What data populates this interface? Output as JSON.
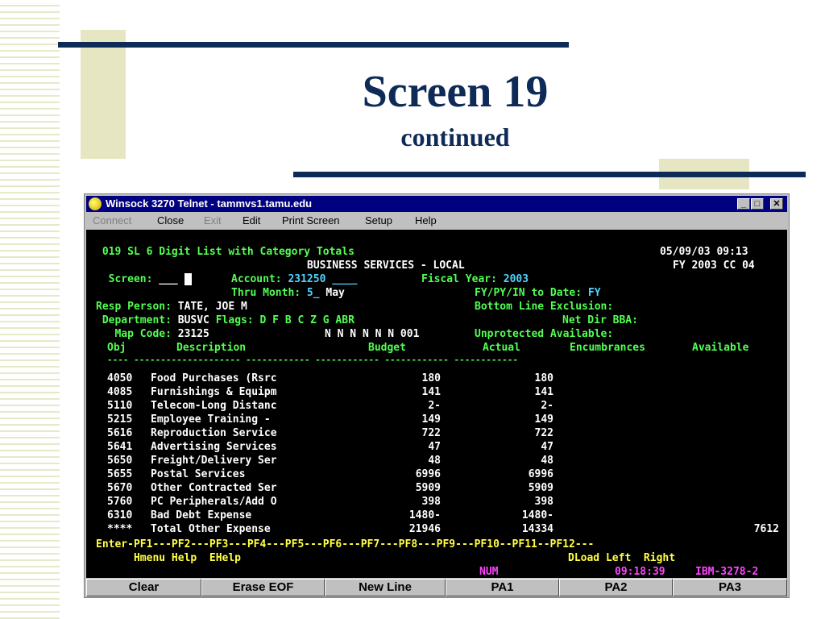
{
  "slide": {
    "title": "Screen 19",
    "subtitle": "continued"
  },
  "window": {
    "title": "Winsock 3270 Telnet - tammvs1.tamu.edu",
    "app_icon": "winsock-globe-icon",
    "controls": [
      "_",
      "□",
      "✕"
    ]
  },
  "menu": {
    "connect": "Connect",
    "close": "Close",
    "exit": "Exit",
    "edit": "Edit",
    "print_screen": "Print Screen",
    "setup": "Setup",
    "help": "Help"
  },
  "terminal": {
    "header_line1": " 019 SL 6 Digit List with Category Totals",
    "date_time": "05/09/03 09:13",
    "header_line2": "BUSINESS SERVICES - LOCAL",
    "fy_cc": "FY 2003 CC 04",
    "screen_label": "  Screen:",
    "screen_value": "___",
    "account_label": "Account:",
    "account_value": "231250 ____",
    "fiscal_year_label": "Fiscal Year:",
    "fiscal_year_value": "2003",
    "thru_month_label": "Thru Month:",
    "thru_month_value": "5_",
    "thru_month_name": "May",
    "to_date_label": "FY/PY/IN to Date:",
    "to_date_value": "FY",
    "resp_person_label": "Resp Person:",
    "resp_person_value": "TATE, JOE M",
    "bottom_line_label": "Bottom Line Exclusion:",
    "department_label": " Department:",
    "department_value": "BUSVC",
    "flags_label": "Flags:",
    "flags_value": "D F B C Z G ABR",
    "net_dir_label": "Net Dir BBA:",
    "map_code_label": "   Map Code:",
    "map_code_value": "23125",
    "flag_values": "N N N N N N 001",
    "unprotected_label": "Unprotected Available:",
    "columns": {
      "obj": "Obj",
      "description": "Description",
      "budget": "Budget",
      "actual": "Actual",
      "encumbrances": "Encumbrances",
      "available": "Available"
    },
    "separator": "---- -------------------- ------------ ------------ ------------ ------------",
    "rows": [
      {
        "obj": "4050",
        "desc": "Food Purchases (Rsrc",
        "budget": "180",
        "actual": "180",
        "available": ""
      },
      {
        "obj": "4085",
        "desc": "Furnishings & Equipm",
        "budget": "141",
        "actual": "141",
        "available": ""
      },
      {
        "obj": "5110",
        "desc": "Telecom-Long Distanc",
        "budget": "2-",
        "actual": "2-",
        "available": ""
      },
      {
        "obj": "5215",
        "desc": "Employee Training -",
        "budget": "149",
        "actual": "149",
        "available": ""
      },
      {
        "obj": "5616",
        "desc": "Reproduction Service",
        "budget": "722",
        "actual": "722",
        "available": ""
      },
      {
        "obj": "5641",
        "desc": "Advertising Services",
        "budget": "47",
        "actual": "47",
        "available": ""
      },
      {
        "obj": "5650",
        "desc": "Freight/Delivery Ser",
        "budget": "48",
        "actual": "48",
        "available": ""
      },
      {
        "obj": "5655",
        "desc": "Postal Services",
        "budget": "6996",
        "actual": "6996",
        "available": ""
      },
      {
        "obj": "5670",
        "desc": "Other Contracted Ser",
        "budget": "5909",
        "actual": "5909",
        "available": ""
      },
      {
        "obj": "5760",
        "desc": "PC Peripherals/Add O",
        "budget": "398",
        "actual": "398",
        "available": ""
      },
      {
        "obj": "6310",
        "desc": "Bad Debt Expense",
        "budget": "1480-",
        "actual": "1480-",
        "available": ""
      },
      {
        "obj": "****",
        "desc": "Total Other Expense",
        "budget": "21946",
        "actual": "14334",
        "available": "7612"
      }
    ],
    "pf_line": "Enter-PF1---PF2---PF3---PF4---PF5---PF6---PF7---PF8---PF9---PF10--PF11--PF12---",
    "pf_labels_left": "      Hmenu Help  EHelp",
    "pf_labels_right": "DLoad Left  Right",
    "status_num": "NUM",
    "status_time": "09:18:39",
    "status_term": "IBM-3278-2"
  },
  "function_keys": [
    "Clear",
    "Erase EOF",
    "New Line",
    "PA1",
    "PA2",
    "PA3"
  ],
  "colors": {
    "title_navy": "#0e2a57",
    "terminal_green": "#52ff52",
    "terminal_cyan": "#4fd4ff",
    "terminal_yellow": "#ffff44",
    "terminal_magenta": "#ff44ff"
  }
}
